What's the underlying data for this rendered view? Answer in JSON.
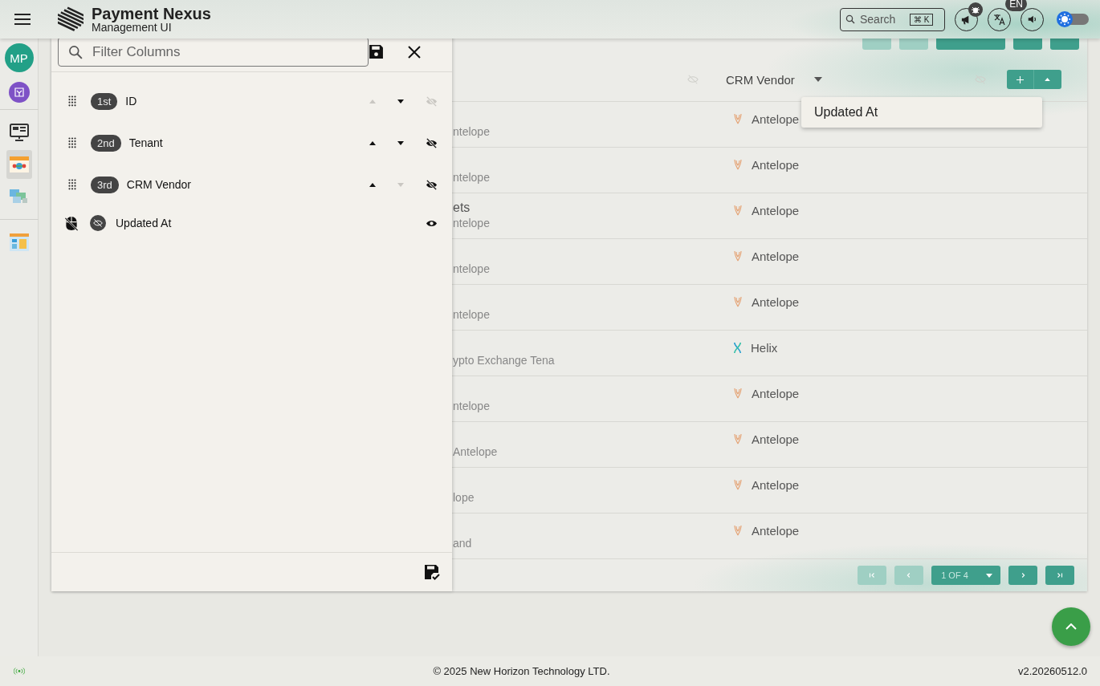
{
  "header": {
    "title": "Payment Nexus",
    "subtitle": "Management UI",
    "search": {
      "placeholder": "Search",
      "shortcut": "⌘ K"
    },
    "language_badge": "EN",
    "theme_toggle": {
      "on": false
    }
  },
  "sidebar": {
    "avatar": "MP",
    "items": [
      {
        "kind": "monitor",
        "selected": false
      },
      {
        "kind": "calendar",
        "selected": true
      },
      {
        "kind": "network",
        "selected": false
      },
      {
        "kind": "board",
        "selected": false
      }
    ]
  },
  "table": {
    "top_pagination": [
      {
        "kind": "first",
        "disabled": true
      },
      {
        "kind": "prev",
        "disabled": true
      },
      {
        "kind": "page"
      },
      {
        "kind": "next",
        "disabled": false
      },
      {
        "kind": "last",
        "disabled": false
      }
    ],
    "vendor_column": {
      "label": "CRM Vendor"
    },
    "rows": [
      {
        "kind": "antelope",
        "tenant_detail": "ntelope",
        "vendor": "Antelope"
      },
      {
        "kind": "antelope",
        "tenant_detail": "ntelope",
        "vendor": "Antelope"
      },
      {
        "kind": "antelope",
        "tenant_name": "ets",
        "tenant_detail": "ntelope",
        "vendor": "Antelope"
      },
      {
        "kind": "antelope",
        "tenant_detail": "ntelope",
        "vendor": "Antelope"
      },
      {
        "kind": "antelope",
        "tenant_detail": "ntelope",
        "vendor": "Antelope"
      },
      {
        "kind": "helix",
        "tenant_detail": "ypto Exchange Tena",
        "vendor": "Helix"
      },
      {
        "kind": "antelope",
        "tenant_detail": "ntelope",
        "vendor": "Antelope"
      },
      {
        "kind": "antelope",
        "tenant_detail": "Antelope",
        "vendor": "Antelope"
      },
      {
        "kind": "antelope",
        "tenant_detail": "lope",
        "vendor": "Antelope"
      },
      {
        "kind": "antelope",
        "tenant_detail": "and",
        "vendor": "Antelope"
      }
    ],
    "bottom_pagination": [
      {
        "kind": "first",
        "disabled": true
      },
      {
        "kind": "prev",
        "disabled": true
      },
      {
        "kind": "page",
        "label": "1 OF 4"
      },
      {
        "kind": "next",
        "disabled": false
      },
      {
        "kind": "last",
        "disabled": false
      }
    ]
  },
  "column_menu": {
    "items": [
      "Updated At"
    ]
  },
  "column_panel": {
    "filter": {
      "placeholder": "Filter Columns"
    },
    "columns": [
      {
        "kind": "ordered",
        "order": "1st",
        "label": "ID",
        "up_disabled": true,
        "down_disabled": false,
        "hide_disabled": true
      },
      {
        "kind": "ordered",
        "order": "2nd",
        "label": "Tenant",
        "up_disabled": false,
        "down_disabled": false,
        "hide_disabled": false
      },
      {
        "kind": "ordered",
        "order": "3rd",
        "label": "CRM Vendor",
        "up_disabled": false,
        "down_disabled": true,
        "hide_disabled": false
      },
      {
        "kind": "hidden",
        "label": "Updated At"
      }
    ]
  },
  "footer": {
    "copyright": "© 2025 New Horizon Technology LTD.",
    "version": "v2.20260512.0"
  }
}
